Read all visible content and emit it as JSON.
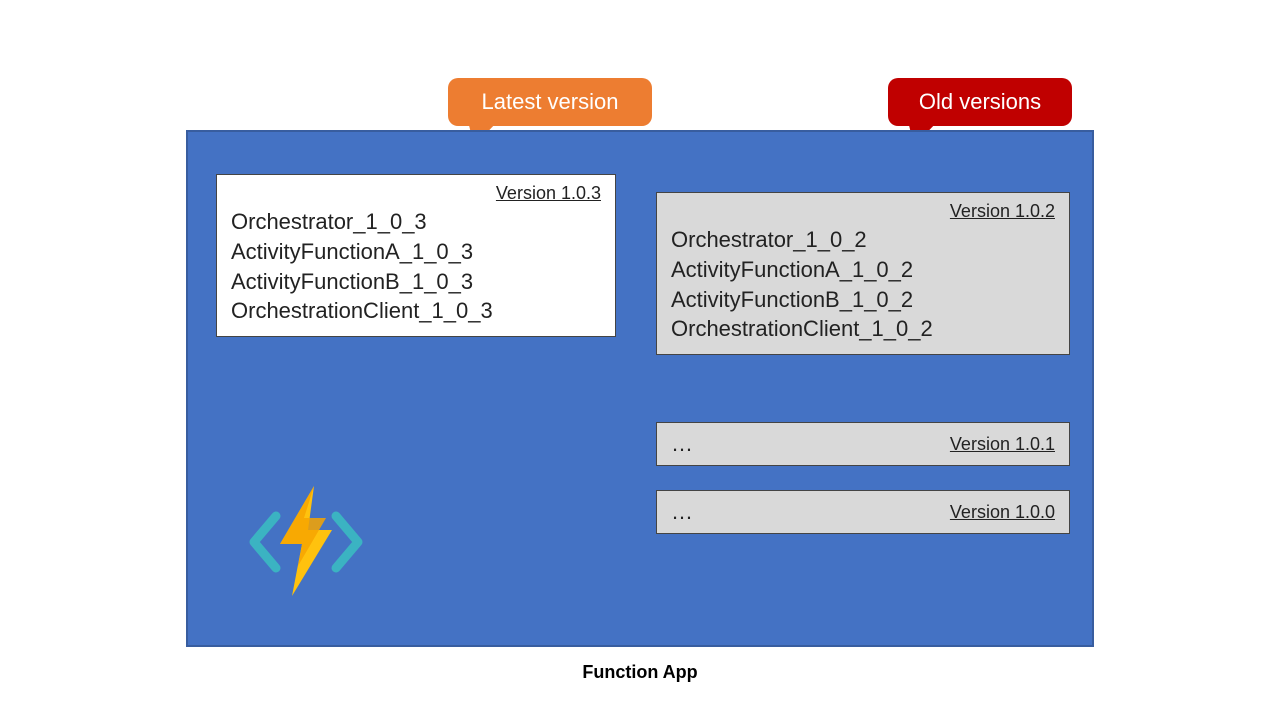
{
  "caption": "Function App",
  "bubbles": {
    "latest": "Latest version",
    "old": "Old versions"
  },
  "colors": {
    "container": "#4472C4",
    "bubble_latest": "#ED7D31",
    "bubble_old": "#C00000",
    "card_old": "#D9D9D9"
  },
  "cards": {
    "latest": {
      "version_label": "Version 1.0.3",
      "lines": [
        "Orchestrator_1_0_3",
        "ActivityFunctionA_1_0_3",
        "ActivityFunctionB_1_0_3",
        "OrchestrationClient_1_0_3"
      ]
    },
    "v102": {
      "version_label": "Version 1.0.2",
      "lines": [
        "Orchestrator_1_0_2",
        "ActivityFunctionA_1_0_2",
        "ActivityFunctionB_1_0_2",
        "OrchestrationClient_1_0_2"
      ]
    },
    "v101": {
      "version_label": "Version 1.0.1",
      "dots": "…"
    },
    "v100": {
      "version_label": "Version 1.0.0",
      "dots": "…"
    }
  },
  "icons": {
    "logo": "azure-functions-icon"
  }
}
